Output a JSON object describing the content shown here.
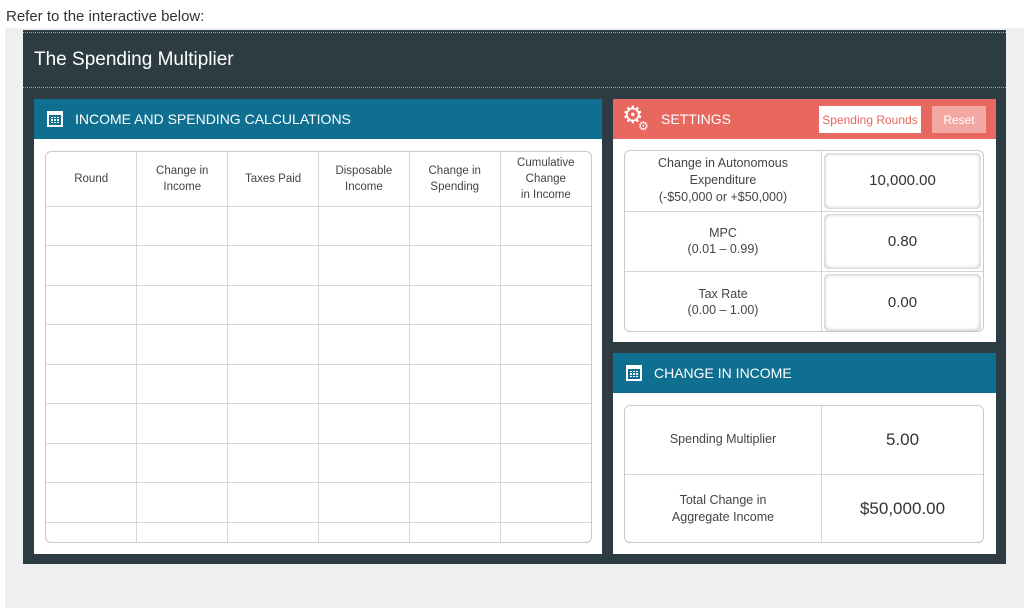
{
  "prompt": "Refer to the interactive below:",
  "app": {
    "title": "The Spending Multiplier"
  },
  "income_panel": {
    "title": "INCOME AND SPENDING CALCULATIONS",
    "columns": [
      {
        "line1": "Round",
        "line2": "",
        "line3": ""
      },
      {
        "line1": "Change in",
        "line2": "Income",
        "line3": ""
      },
      {
        "line1": "Taxes Paid",
        "line2": "",
        "line3": ""
      },
      {
        "line1": "Disposable",
        "line2": "Income",
        "line3": ""
      },
      {
        "line1": "Change in",
        "line2": "Spending",
        "line3": ""
      },
      {
        "line1": "Cumulative",
        "line2": "Change",
        "line3": "in Income"
      }
    ],
    "row_count": 9
  },
  "settings": {
    "title": "SETTINGS",
    "spending_rounds_label": "Spending Rounds",
    "reset_label": "Reset",
    "rows": [
      {
        "label1": "Change in Autonomous",
        "label2": "Expenditure",
        "label3": "(-$50,000 or +$50,000)",
        "value": "10,000.00"
      },
      {
        "label1": "MPC",
        "label2": "(0.01 – 0.99)",
        "label3": "",
        "value": "0.80"
      },
      {
        "label1": "Tax Rate",
        "label2": "(0.00 – 1.00)",
        "label3": "",
        "value": "0.00"
      }
    ]
  },
  "change_in_income": {
    "title": "CHANGE IN INCOME",
    "rows": [
      {
        "label1": "Spending Multiplier",
        "label2": "",
        "value": "5.00"
      },
      {
        "label1": "Total Change in",
        "label2": "Aggregate Income",
        "value": "$50,000.00"
      }
    ]
  },
  "colors": {
    "app_bg": "#2d3c42",
    "teal": "#0f6f90",
    "coral": "#e8675f"
  }
}
